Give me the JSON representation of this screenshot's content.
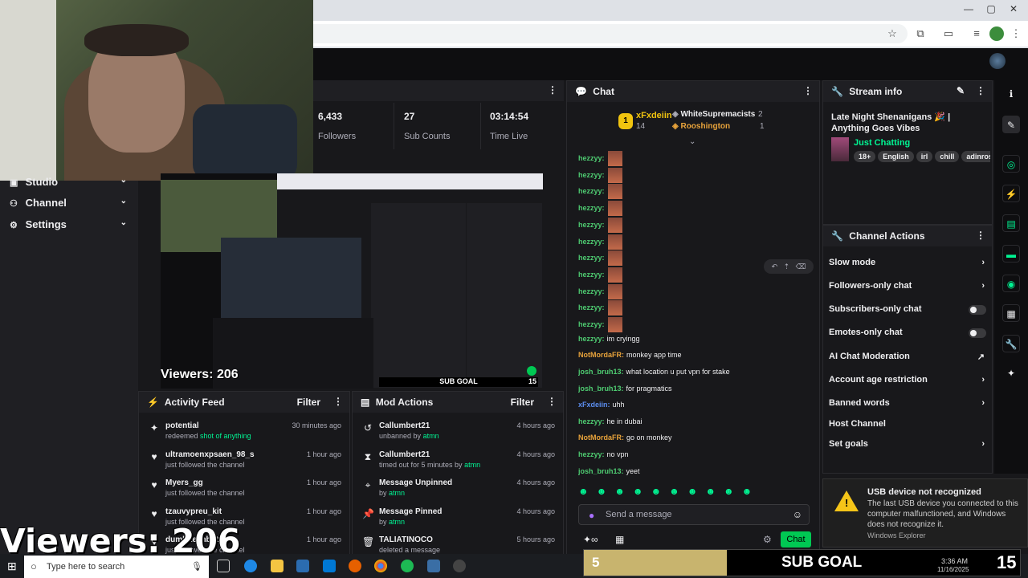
{
  "browser": {
    "window_controls": {
      "minimize": "—",
      "maximize": "▢",
      "close": "✕"
    }
  },
  "sidebar": {
    "items": [
      {
        "label": "Studio",
        "icon": "studio-icon"
      },
      {
        "label": "Channel",
        "icon": "channel-icon"
      },
      {
        "label": "Settings",
        "icon": "gear-icon"
      }
    ]
  },
  "stats": {
    "followers": {
      "value": "6,433",
      "label": "Followers"
    },
    "subs": {
      "value": "27",
      "label": "Sub Counts"
    },
    "time": {
      "value": "03:14:54",
      "label": "Time Live"
    }
  },
  "preview": {
    "viewers": "Viewers: 206",
    "subgoal": "SUB GOAL",
    "count": "15"
  },
  "chat": {
    "title": "Chat",
    "leaderboard": {
      "rank": "1",
      "top_user": "xFxdeiin",
      "top_count": "14",
      "entries": [
        {
          "name": "WhiteSupremacists",
          "count": "2"
        },
        {
          "name": "Rooshington",
          "count": "1"
        }
      ]
    },
    "messages": [
      {
        "user": "hezzyy:",
        "text": "",
        "emote": true,
        "color": "#4ecb71"
      },
      {
        "user": "hezzyy:",
        "text": "",
        "emote": true,
        "color": "#4ecb71"
      },
      {
        "user": "hezzyy:",
        "text": "",
        "emote": true,
        "color": "#4ecb71"
      },
      {
        "user": "hezzyy:",
        "text": "",
        "emote": true,
        "color": "#4ecb71"
      },
      {
        "user": "hezzyy:",
        "text": "",
        "emote": true,
        "color": "#4ecb71"
      },
      {
        "user": "hezzyy:",
        "text": "",
        "emote": true,
        "color": "#4ecb71"
      },
      {
        "user": "hezzyy:",
        "text": "",
        "emote": true,
        "color": "#4ecb71"
      },
      {
        "user": "hezzyy:",
        "text": "",
        "emote": true,
        "color": "#4ecb71"
      },
      {
        "user": "hezzyy:",
        "text": "",
        "emote": true,
        "color": "#4ecb71"
      },
      {
        "user": "hezzyy:",
        "text": "",
        "emote": true,
        "color": "#4ecb71"
      },
      {
        "user": "hezzyy:",
        "text": "",
        "emote": true,
        "color": "#4ecb71"
      },
      {
        "user": "hezzyy:",
        "text": "im cryingg",
        "emote": false,
        "color": "#4ecb71"
      },
      {
        "user": "NotMordaFR:",
        "text": "monkey app time",
        "emote": false,
        "color": "#e8a33b"
      },
      {
        "user": "josh_bruh13:",
        "text": "what location u put vpn for stake",
        "emote": false,
        "color": "#4ecb71"
      },
      {
        "user": "josh_bruh13:",
        "text": "for pragmatics",
        "emote": false,
        "color": "#4ecb71"
      },
      {
        "user": "xFxdeiin:",
        "text": "uhh",
        "emote": false,
        "color": "#5b8def"
      },
      {
        "user": "hezzyy:",
        "text": "he in dubai",
        "emote": false,
        "color": "#4ecb71"
      },
      {
        "user": "NotMordaFR:",
        "text": "go on monkey",
        "emote": false,
        "color": "#e8a33b"
      },
      {
        "user": "hezzyy:",
        "text": "no vpn",
        "emote": false,
        "color": "#4ecb71"
      },
      {
        "user": "josh_bruh13:",
        "text": "yeet",
        "emote": false,
        "color": "#4ecb71"
      }
    ],
    "input_placeholder": "Send a message",
    "send_label": "Chat"
  },
  "stream_info": {
    "title": "Stream info",
    "stream_title": "Late Night Shenanigans 🎉 | Anything Goes Vibes",
    "category": "Just Chatting",
    "tags": [
      "18+",
      "English",
      "irl",
      "chill",
      "adinross"
    ]
  },
  "channel_actions": {
    "title": "Channel Actions",
    "items": [
      {
        "label": "Slow mode",
        "type": "chevron"
      },
      {
        "label": "Followers-only chat",
        "type": "chevron"
      },
      {
        "label": "Subscribers-only chat",
        "type": "toggle"
      },
      {
        "label": "Emotes-only chat",
        "type": "toggle"
      },
      {
        "label": "AI Chat Moderation",
        "type": "external"
      },
      {
        "label": "Account age restriction",
        "type": "chevron"
      },
      {
        "label": "Banned words",
        "type": "chevron"
      },
      {
        "label": "Host Channel",
        "type": "none"
      },
      {
        "label": "Set goals",
        "type": "chevron"
      }
    ]
  },
  "activity_feed": {
    "title": "Activity Feed",
    "filter": "Filter",
    "items": [
      {
        "user": "potential",
        "action": "redeemed ",
        "highlight": "shot of anything",
        "time": "30 minutes ago",
        "icon": "points-icon"
      },
      {
        "user": "ultramoenxpsaen_98_s",
        "action": "just followed the channel",
        "highlight": "",
        "time": "1 hour ago",
        "icon": "heart-icon"
      },
      {
        "user": "Myers_gg",
        "action": "just followed the channel",
        "highlight": "",
        "time": "1 hour ago",
        "icon": "heart-icon"
      },
      {
        "user": "tzauvypreu_kit",
        "action": "just followed the channel",
        "highlight": "",
        "time": "1 hour ago",
        "icon": "heart-icon"
      },
      {
        "user": "dumbiteanbot",
        "action": "just followed the channel",
        "highlight": "",
        "time": "1 hour ago",
        "icon": "heart-icon"
      }
    ]
  },
  "mod_actions": {
    "title": "Mod Actions",
    "filter": "Filter",
    "items": [
      {
        "title": "Callumbert21",
        "action": "unbanned by ",
        "by": "atmn",
        "time": "4 hours ago",
        "icon": "unban-icon"
      },
      {
        "title": "Callumbert21",
        "action": "timed out for 5 minutes by ",
        "by": "atmn",
        "time": "4 hours ago",
        "icon": "hourglass-icon"
      },
      {
        "title": "Message Unpinned",
        "action": "by ",
        "by": "atmn",
        "time": "4 hours ago",
        "icon": "unpin-icon"
      },
      {
        "title": "Message Pinned",
        "action": "by ",
        "by": "atmn",
        "time": "4 hours ago",
        "icon": "pin-icon"
      },
      {
        "title": "TALIATINOCO",
        "action": "deleted a message",
        "by": "",
        "time": "5 hours ago",
        "icon": "trash-icon"
      }
    ]
  },
  "overlay": {
    "viewers": "Viewers: 206",
    "subgoal_count": "5",
    "subgoal": "SUB GOAL",
    "subgoal_target": "15"
  },
  "notification": {
    "title": "USB device not recognized",
    "body": "The last USB device you connected to this computer malfunctioned, and Windows does not recognize it.",
    "source": "Windows Explorer"
  },
  "taskbar": {
    "search_placeholder": "Type here to search",
    "time": "3:36 AM",
    "date": "11/16/2025"
  }
}
